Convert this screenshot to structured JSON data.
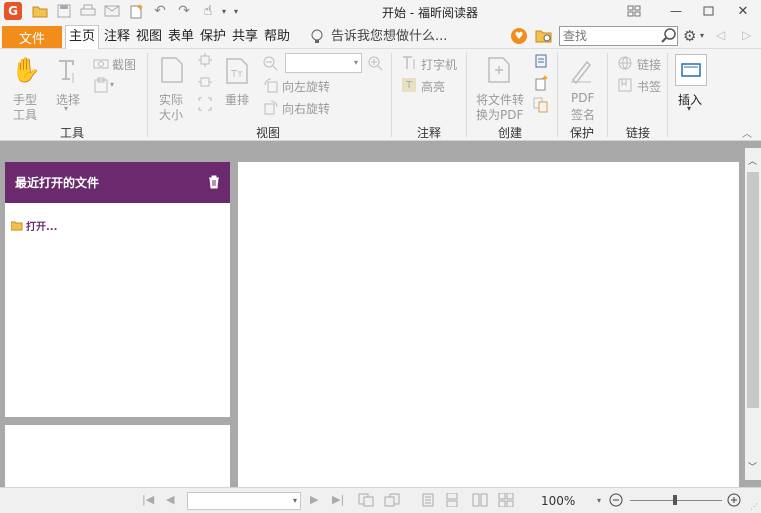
{
  "window": {
    "title": "开始 - 福昕阅读器"
  },
  "menu": {
    "file": "文件",
    "tabs": [
      "主页",
      "注释",
      "视图",
      "表单",
      "保护",
      "共享",
      "帮助"
    ],
    "tell_me": "告诉我您想做什么...",
    "search_placeholder": "查找"
  },
  "ribbon": {
    "hand": "手型\n工具",
    "hand_l1": "手型",
    "hand_l2": "工具",
    "select": "选择",
    "screenshot": "截图",
    "tools_group": "工具",
    "actual_l1": "实际",
    "actual_l2": "大小",
    "reflow": "重排",
    "rotate_left": "向左旋转",
    "rotate_right": "向右旋转",
    "view_group": "视图",
    "typewriter": "打字机",
    "highlight": "高亮",
    "comment_group": "注释",
    "convert_l1": "将文件转",
    "convert_l2": "换为PDF",
    "create_group": "创建",
    "sign_l1": "PDF",
    "sign_l2": "签名",
    "protect_group": "保护",
    "link": "链接",
    "bookmark": "书签",
    "links_group": "链接",
    "insert": "插入"
  },
  "panel": {
    "title": "最近打开的文件",
    "open": "打开..."
  },
  "status": {
    "zoom": "100%"
  },
  "colors": {
    "accent": "#f28c1b",
    "panel_header": "#6b2a6e"
  }
}
